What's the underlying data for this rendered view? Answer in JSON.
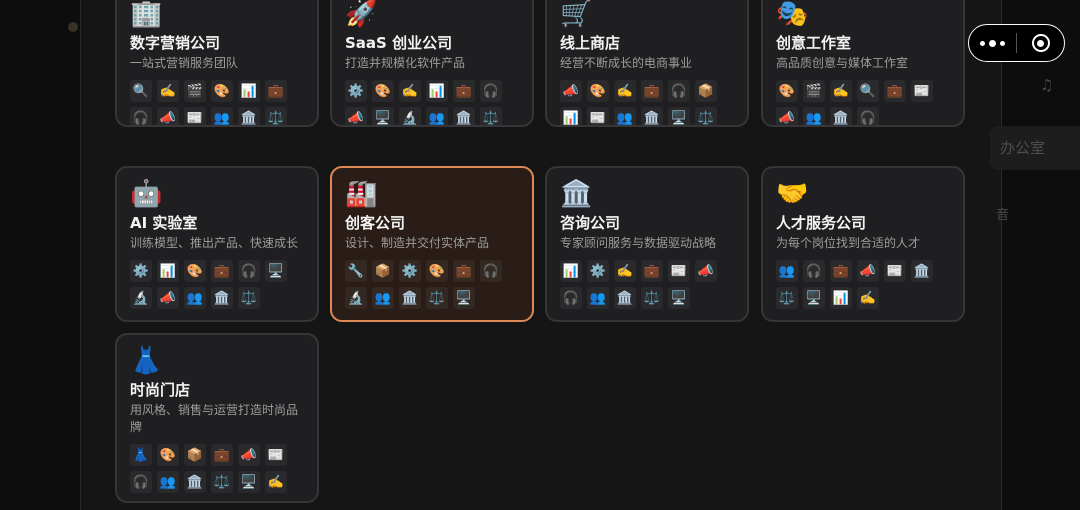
{
  "background": {
    "ghost_music": "♫",
    "ghost_chip": "办公室",
    "ghost_note": "音"
  },
  "capsule": {
    "more_label": "more",
    "close_label": "close"
  },
  "cards": [
    {
      "emoji": "🏢",
      "title": "数字营销公司",
      "desc": "一站式营销服务团队",
      "icons": [
        "🔍",
        "✍️",
        "🎬",
        "🎨",
        "📊",
        "💼",
        "🎧",
        "📣",
        "📰",
        "👥",
        "🏛️",
        "⚖️",
        "🖥️"
      ]
    },
    {
      "emoji": "🚀",
      "title": "SaaS 创业公司",
      "desc": "打造并规模化软件产品",
      "icons": [
        "⚙️",
        "🎨",
        "✍️",
        "📊",
        "💼",
        "🎧",
        "📣",
        "🖥️",
        "🔬",
        "👥",
        "🏛️",
        "⚖️"
      ]
    },
    {
      "emoji": "🛒",
      "title": "线上商店",
      "desc": "经营不断成长的电商事业",
      "icons": [
        "📣",
        "🎨",
        "✍️",
        "💼",
        "🎧",
        "📦",
        "📊",
        "📰",
        "👥",
        "🏛️",
        "🖥️",
        "⚖️"
      ]
    },
    {
      "emoji": "🎭",
      "title": "创意工作室",
      "desc": "高品质创意与媒体工作室",
      "icons": [
        "🎨",
        "🎬",
        "✍️",
        "🔍",
        "💼",
        "📰",
        "📣",
        "👥",
        "🏛️",
        "🎧"
      ]
    },
    {
      "emoji": "🤖",
      "title": "AI 实验室",
      "desc": "训练模型、推出产品、快速成长",
      "icons": [
        "⚙️",
        "📊",
        "🎨",
        "💼",
        "🎧",
        "🖥️",
        "🔬",
        "📣",
        "👥",
        "🏛️",
        "⚖️"
      ]
    },
    {
      "emoji": "🏭",
      "title": "创客公司",
      "desc": "设计、制造并交付实体产品",
      "selected": true,
      "icons": [
        "🔧",
        "📦",
        "⚙️",
        "🎨",
        "💼",
        "🎧",
        "🔬",
        "👥",
        "🏛️",
        "⚖️",
        "🖥️"
      ]
    },
    {
      "emoji": "🏛️",
      "title": "咨询公司",
      "desc": "专家顾问服务与数据驱动战略",
      "icons": [
        "📊",
        "⚙️",
        "✍️",
        "💼",
        "📰",
        "📣",
        "🎧",
        "👥",
        "🏛️",
        "⚖️",
        "🖥️"
      ]
    },
    {
      "emoji": "🤝",
      "title": "人才服务公司",
      "desc": "为每个岗位找到合适的人才",
      "icons": [
        "👥",
        "🎧",
        "💼",
        "📣",
        "📰",
        "🏛️",
        "⚖️",
        "🖥️",
        "📊",
        "✍️"
      ]
    },
    {
      "emoji": "👗",
      "title": "时尚门店",
      "desc": "用风格、销售与运营打造时尚品牌",
      "icons": [
        "👗",
        "🎨",
        "📦",
        "💼",
        "📣",
        "📰",
        "🎧",
        "👥",
        "🏛️",
        "⚖️",
        "🖥️",
        "✍️"
      ]
    }
  ]
}
